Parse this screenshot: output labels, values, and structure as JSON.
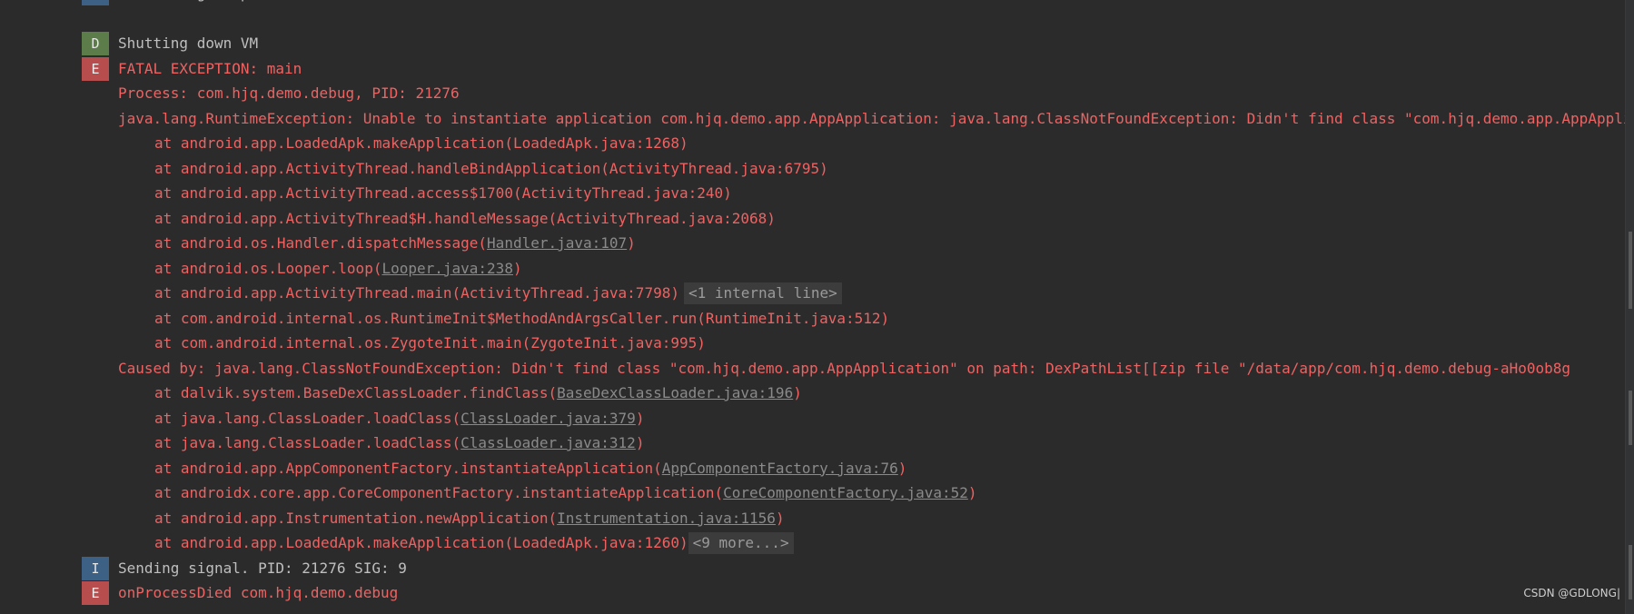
{
  "log": {
    "rows": [
      {
        "level": "I",
        "color": "info",
        "segments": [
          {
            "text": "Connecting to perf service."
          }
        ]
      },
      {
        "level": "",
        "color": "info",
        "segments": []
      },
      {
        "level": "D",
        "color": "info",
        "segments": [
          {
            "text": "Shutting down VM"
          }
        ]
      },
      {
        "level": "E",
        "color": "err",
        "segments": [
          {
            "text": "FATAL EXCEPTION: main"
          }
        ]
      },
      {
        "level": "",
        "indent": "cont",
        "color": "err",
        "segments": [
          {
            "text": "Process: com.hjq.demo.debug, PID: 21276"
          }
        ]
      },
      {
        "level": "",
        "indent": "cont",
        "color": "err",
        "segments": [
          {
            "text": "java.lang.RuntimeException: Unable to instantiate application com.hjq.demo.app.AppApplication: java.lang.ClassNotFoundException: Didn't find class \"com.hjq.demo.app.AppApplication\" on path: DexPathList"
          }
        ]
      },
      {
        "level": "",
        "indent": "frame",
        "color": "err",
        "segments": [
          {
            "text": "at android.app.LoadedApk.makeApplication(LoadedApk.java:1268)"
          }
        ]
      },
      {
        "level": "",
        "indent": "frame",
        "color": "err",
        "segments": [
          {
            "text": "at android.app.ActivityThread.handleBindApplication(ActivityThread.java:6795)"
          }
        ]
      },
      {
        "level": "",
        "indent": "frame",
        "color": "err",
        "segments": [
          {
            "text": "at android.app.ActivityThread.access$1700(ActivityThread.java:240)"
          }
        ]
      },
      {
        "level": "",
        "indent": "frame",
        "color": "err",
        "segments": [
          {
            "text": "at android.app.ActivityThread$H.handleMessage(ActivityThread.java:2068)"
          }
        ]
      },
      {
        "level": "",
        "indent": "frame",
        "color": "err",
        "segments": [
          {
            "text": "at android.os.Handler.dispatchMessage("
          },
          {
            "text": "Handler.java:107",
            "link": true
          },
          {
            "text": ")"
          }
        ]
      },
      {
        "level": "",
        "indent": "frame",
        "color": "err",
        "segments": [
          {
            "text": "at android.os.Looper.loop("
          },
          {
            "text": "Looper.java:238",
            "link": true
          },
          {
            "text": ")"
          }
        ]
      },
      {
        "level": "",
        "indent": "frame",
        "color": "err",
        "segments": [
          {
            "text": "at android.app.ActivityThread.main(ActivityThread.java:7798)"
          },
          {
            "text": "<1 internal line>",
            "fold": true
          }
        ]
      },
      {
        "level": "",
        "indent": "frame",
        "color": "err",
        "segments": [
          {
            "text": "at com.android.internal.os.RuntimeInit$MethodAndArgsCaller.run(RuntimeInit.java:512)"
          }
        ]
      },
      {
        "level": "",
        "indent": "frame",
        "color": "err",
        "segments": [
          {
            "text": "at com.android.internal.os.ZygoteInit.main(ZygoteInit.java:995)"
          }
        ]
      },
      {
        "level": "",
        "indent": "cont",
        "color": "err",
        "segments": [
          {
            "text": "Caused by: java.lang.ClassNotFoundException: Didn't find class \"com.hjq.demo.app.AppApplication\" on path: DexPathList[[zip file \"/data/app/com.hjq.demo.debug-aHo0ob8g"
          }
        ]
      },
      {
        "level": "",
        "indent": "frame",
        "color": "err",
        "segments": [
          {
            "text": "at dalvik.system.BaseDexClassLoader.findClass("
          },
          {
            "text": "BaseDexClassLoader.java:196",
            "link": true
          },
          {
            "text": ")"
          }
        ]
      },
      {
        "level": "",
        "indent": "frame",
        "color": "err",
        "segments": [
          {
            "text": "at java.lang.ClassLoader.loadClass("
          },
          {
            "text": "ClassLoader.java:379",
            "link": true
          },
          {
            "text": ")"
          }
        ]
      },
      {
        "level": "",
        "indent": "frame",
        "color": "err",
        "segments": [
          {
            "text": "at java.lang.ClassLoader.loadClass("
          },
          {
            "text": "ClassLoader.java:312",
            "link": true
          },
          {
            "text": ")"
          }
        ]
      },
      {
        "level": "",
        "indent": "frame",
        "color": "err",
        "segments": [
          {
            "text": "at android.app.AppComponentFactory.instantiateApplication("
          },
          {
            "text": "AppComponentFactory.java:76",
            "link": true
          },
          {
            "text": ")"
          }
        ]
      },
      {
        "level": "",
        "indent": "frame",
        "color": "err",
        "segments": [
          {
            "text": "at androidx.core.app.CoreComponentFactory.instantiateApplication("
          },
          {
            "text": "CoreComponentFactory.java:52",
            "link": true
          },
          {
            "text": ")"
          }
        ]
      },
      {
        "level": "",
        "indent": "frame",
        "color": "err",
        "segments": [
          {
            "text": "at android.app.Instrumentation.newApplication("
          },
          {
            "text": "Instrumentation.java:1156",
            "link": true
          },
          {
            "text": ")"
          }
        ]
      },
      {
        "level": "",
        "indent": "frame",
        "color": "err",
        "segments": [
          {
            "text": "at android.app.LoadedApk.makeApplication(LoadedApk.java:1260)"
          },
          {
            "text": "<9 more...>",
            "fold": true,
            "tight": true
          }
        ]
      },
      {
        "level": "I",
        "color": "info",
        "segments": [
          {
            "text": "Sending signal. PID: 21276 SIG: 9"
          }
        ]
      },
      {
        "level": "E",
        "color": "err",
        "segments": [
          {
            "text": "onProcessDied com.hjq.demo.debug"
          }
        ]
      }
    ]
  },
  "watermark": "CSDN @GDLONG|",
  "colors": {
    "background": "#2b2b2b",
    "info_text": "#bfbfbf",
    "error_text": "#ee6262",
    "badge_info": "#3d6185",
    "badge_debug": "#5c7c4a",
    "badge_error": "#b84d4d",
    "link_text": "#8a8a8a",
    "fold_bg": "#3c3c3c"
  }
}
